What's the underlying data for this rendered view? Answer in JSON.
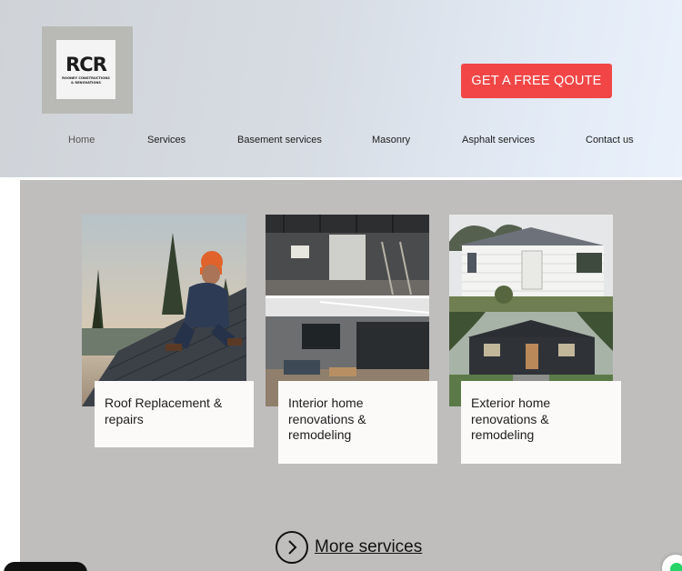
{
  "logo": {
    "mark": "RCR",
    "subtitle_line1": "ROONEY CONSTRUCTIONS",
    "subtitle_line2": "& RENOVATIONS"
  },
  "header": {
    "cta_label": "GET A FREE QOUTE"
  },
  "nav": {
    "items": [
      {
        "label": "Home",
        "active": true
      },
      {
        "label": "Services",
        "active": false
      },
      {
        "label": "Basement services",
        "active": false
      },
      {
        "label": "Masonry",
        "active": false
      },
      {
        "label": "Asphalt services",
        "active": false
      },
      {
        "label": "Contact us",
        "active": false
      }
    ]
  },
  "services": {
    "cards": [
      {
        "line1": "Roof Replacement &",
        "line2": "repairs",
        "line3": ""
      },
      {
        "line1": "Interior home",
        "line2": "renovations &",
        "line3": "remodeling"
      },
      {
        "line1": "Exterior home",
        "line2": "renovations &",
        "line3": "remodeling"
      }
    ]
  },
  "more_services": {
    "label": "More services",
    "icon": "chevron-right-icon"
  },
  "colors": {
    "cta": "#f24646",
    "panel": "#bfbebd",
    "caption_bg": "#fcfaf9",
    "whatsapp": "#25d366"
  }
}
